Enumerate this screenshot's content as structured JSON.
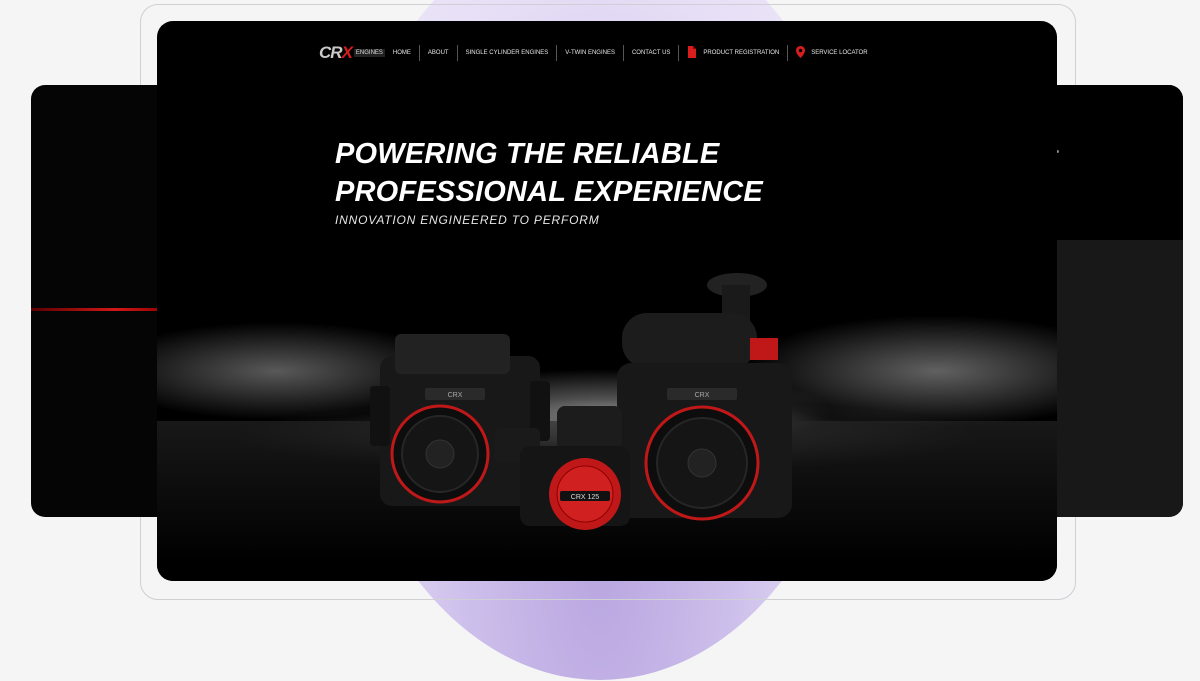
{
  "brand": {
    "logo_main": "CR",
    "logo_accent": "X",
    "logo_sub": "ENGINES"
  },
  "nav": {
    "items": [
      {
        "label": "HOME"
      },
      {
        "label": "ABOUT"
      },
      {
        "label": "SINGLE CYLINDER ENGINES"
      },
      {
        "label": "V-TWIN ENGINES"
      },
      {
        "label": "CONTACT US"
      },
      {
        "label": "PRODUCT REGISTRATION",
        "icon": "document-icon"
      },
      {
        "label": "SERVICE LOCATOR",
        "icon": "map-pin-icon"
      }
    ]
  },
  "hero": {
    "line1": "POWERING THE RELIABLE",
    "line2": "PROFESSIONAL EXPERIENCE",
    "tagline": "INNOVATION ENGINEERED TO PERFORM"
  },
  "engines": [
    {
      "badge": "CRX"
    },
    {
      "badge": "CRX 125"
    },
    {
      "badge": "CRX"
    }
  ],
  "colors": {
    "accent": "#d81d1d",
    "background": "#000000",
    "page": "#f5f5f6",
    "decor_circle": "#c2b1e6"
  }
}
